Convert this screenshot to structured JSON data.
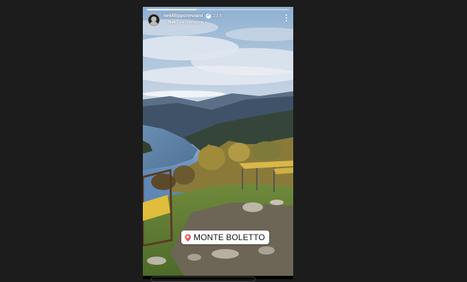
{
  "story": {
    "username": "nekfilipponeviani",
    "time_ago": "23 h",
    "music_artist": "Nek",
    "music_separator": "·",
    "music_title": "Le montagne",
    "location_sticker": "MONTE BOLETTO",
    "progress_fraction": 0.35
  },
  "icons": {
    "verified": "verified-badge-icon",
    "music": "music-note-icon",
    "more": "more-options-icon",
    "location": "location-pin-icon"
  },
  "colors": {
    "background": "#1c1c1c",
    "pin_gradient_start": "#f7a036",
    "pin_gradient_end": "#d6249f"
  }
}
